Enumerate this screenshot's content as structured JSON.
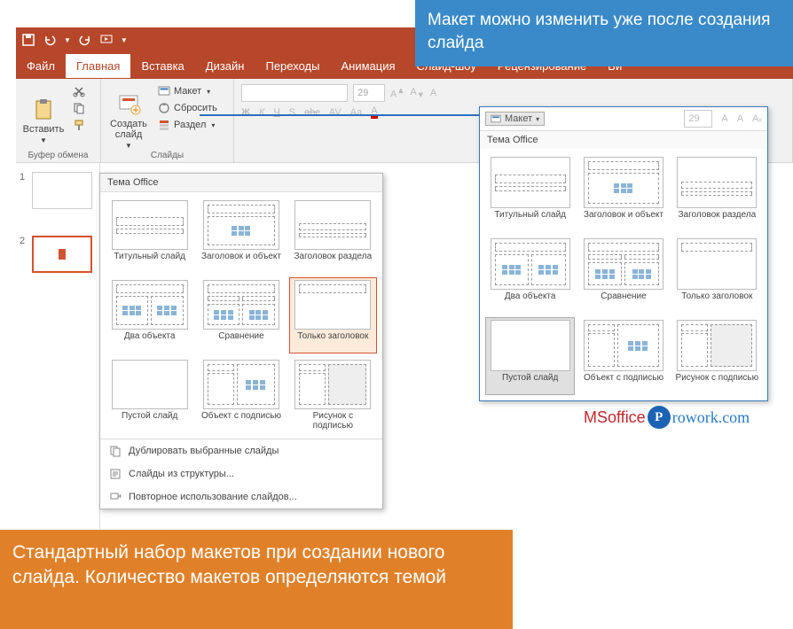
{
  "callouts": {
    "blue": "Макет можно изменить уже после создания слайда",
    "orange": "Стандартный набор макетов при создании нового слайда. Количество макетов определяются темой"
  },
  "qat": {
    "save": "save",
    "undo": "undo",
    "redo": "redo",
    "start": "start"
  },
  "tabs": {
    "file": "Файл",
    "home": "Главная",
    "insert": "Вставка",
    "design": "Дизайн",
    "transitions": "Переходы",
    "animations": "Анимация",
    "slideshow": "Слайд-шоу",
    "review": "Рецензирование",
    "view": "Ви"
  },
  "ribbon": {
    "clipboard": {
      "paste": "Вставить",
      "group_label": "Буфер обмена"
    },
    "slides": {
      "new_slide": "Создать слайд",
      "layout": "Макет",
      "reset": "Сбросить",
      "section": "Раздел",
      "group_label": "Слайды"
    },
    "font": {
      "size": "29",
      "bold": "Ж",
      "italic": "К",
      "underline": "Ч",
      "shadow": "S",
      "strike": "abc",
      "spacing": "AV",
      "case": "Aa"
    }
  },
  "gallery": {
    "header": "Тема Office",
    "layouts": [
      "Титульный слайд",
      "Заголовок и объект",
      "Заголовок раздела",
      "Два объекта",
      "Сравнение",
      "Только заголовок",
      "Пустой слайд",
      "Объект с подписью",
      "Рисунок с подписью"
    ],
    "footer": {
      "duplicate": "Дублировать выбранные слайды",
      "outline": "Слайды из структуры...",
      "reuse": "Повторное использование слайдов..."
    }
  },
  "gallery2": {
    "layout_btn": "Макет",
    "header": "Тема Office",
    "font_size": "29",
    "layouts": [
      "Титульный слайд",
      "Заголовок и объект",
      "Заголовок раздела",
      "Два объекта",
      "Сравнение",
      "Только заголовок",
      "Пустой слайд",
      "Объект с подписью",
      "Рисунок с подписью"
    ]
  },
  "slides": {
    "s1": "1",
    "s2": "2"
  },
  "watermark": {
    "pre": "MSoffice",
    "p": "P",
    "post": "rowork.com"
  }
}
